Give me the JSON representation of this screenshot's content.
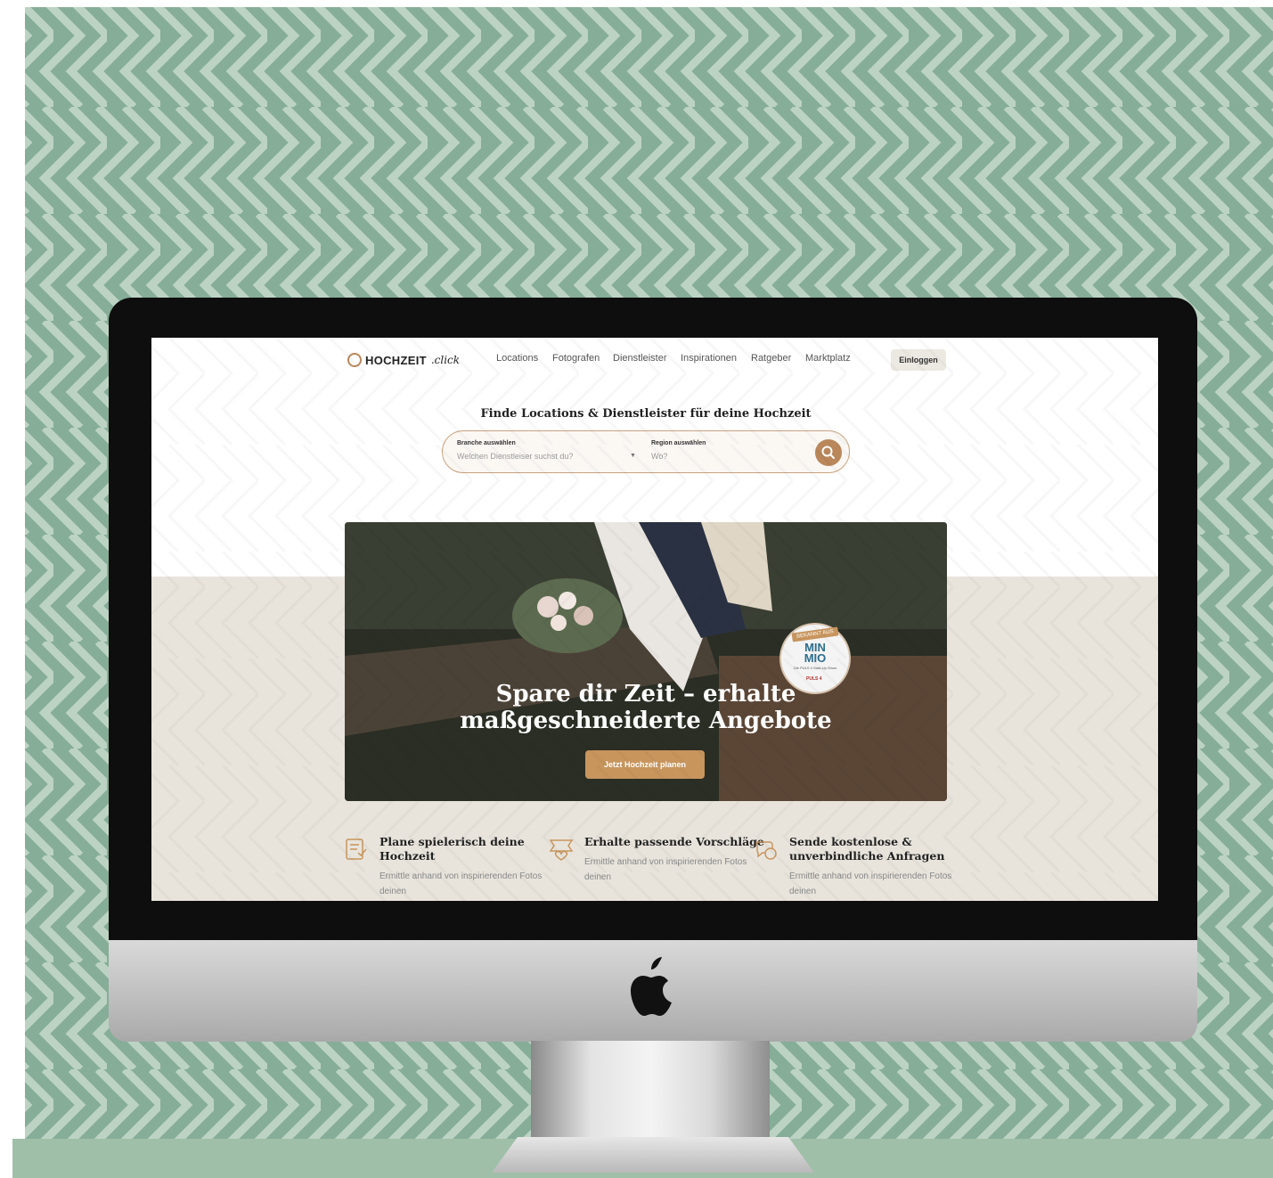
{
  "nav": {
    "logo_main": "HOCHZEIT",
    "logo_script": ".click",
    "links": [
      "Locations",
      "Fotografen",
      "Dienstleister",
      "Inspirationen",
      "Ratgeber",
      "Marktplatz"
    ],
    "login": "Einloggen"
  },
  "search": {
    "title": "Finde Locations & Dienstleister für deine Hochzeit",
    "branche_label": "Branche auswählen",
    "branche_placeholder": "Welchen Dienstleiser suchst du?",
    "region_label": "Region auswählen",
    "region_placeholder": "Wo?",
    "search_icon": "search-icon"
  },
  "hero": {
    "title_line1": "Spare dir Zeit – erhalte",
    "title_line2": "maßgeschneiderte Angebote",
    "cta": "Jetzt Hochzeit planen",
    "badge_top": "BEKANNT AUS",
    "badge_main1": "MIN",
    "badge_main2": "MIO",
    "badge_sub": "Die PULS 4 Start-Up Show",
    "badge_logo": "PULS 4"
  },
  "features": [
    {
      "icon": "checklist-icon",
      "title": "Plane spielerisch deine Hochzeit",
      "text": "Ermittle anhand von inspirierenden Fotos deinen"
    },
    {
      "icon": "suggestion-icon",
      "title": "Erhalte passende Vorschläge",
      "text": "Ermittle anhand von inspirierenden Fotos deinen"
    },
    {
      "icon": "chat-icon",
      "title": "Sende kostenlose & unverbindliche Anfragen",
      "text": "Ermittle anhand von inspirierenden Fotos deinen"
    }
  ],
  "colors": {
    "background_pattern_dark": "#7fa690",
    "background_pattern_light": "#b4cdbd",
    "accent": "#c8955d",
    "sand": "#e8e4dc"
  }
}
